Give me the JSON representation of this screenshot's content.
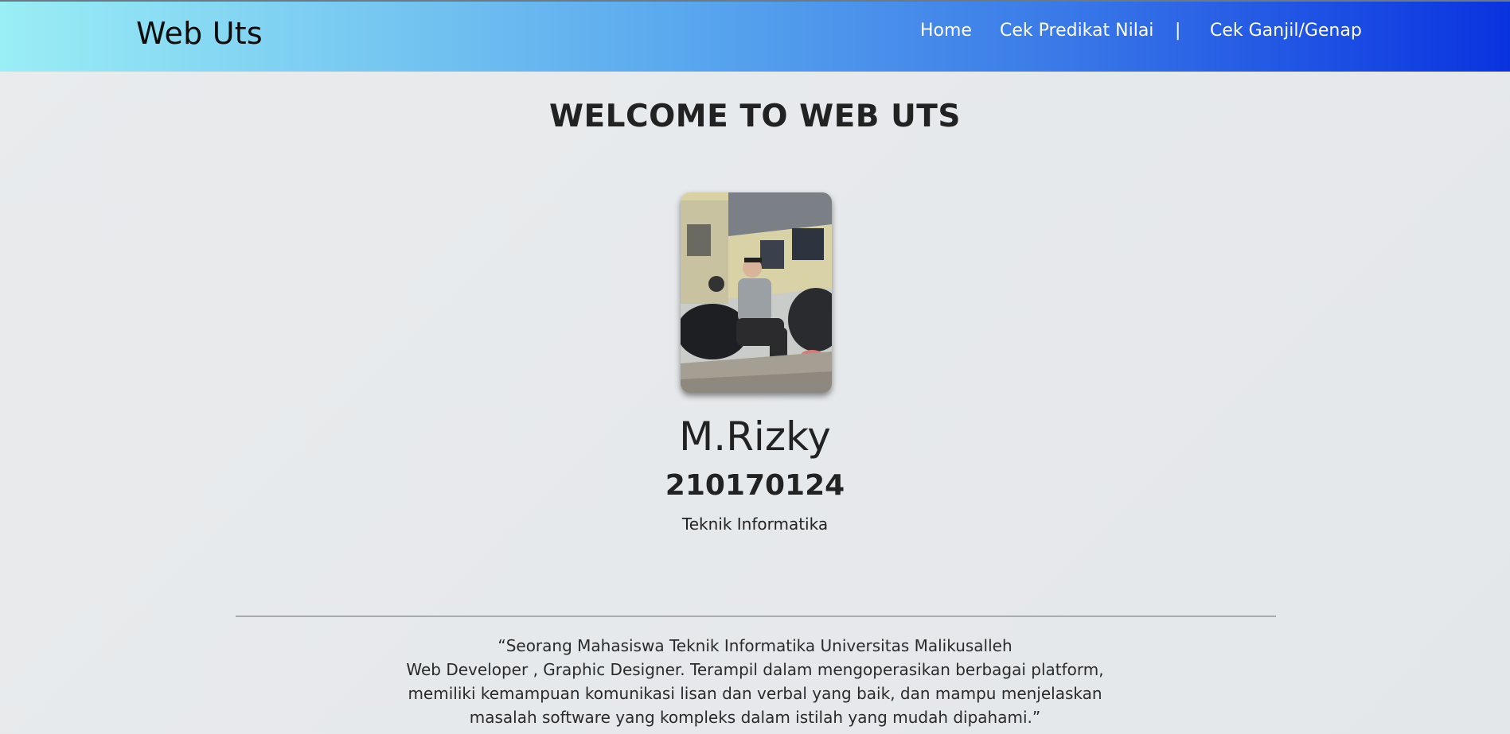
{
  "header": {
    "brand": "Web Uts",
    "nav": {
      "home": "Home",
      "predikat": "Cek Predikat Nilai",
      "separator": "|",
      "ganjil": "Cek Ganjil/Genap"
    }
  },
  "main": {
    "welcome": "WELCOME TO WEB UTS",
    "profile_photo": "profile-photo",
    "name": "M.Rizky",
    "nim": "210170124",
    "major": "Teknik Informatika",
    "quote": [
      "“Seorang Mahasiswa Teknik Informatika Universitas Malikusalleh",
      "Web Developer , Graphic Designer. Terampil dalam mengoperasikan berbagai platform,",
      "memiliki kemampuan komunikasi lisan dan verbal yang baik, dan mampu menjelaskan",
      "masalah software yang kompleks dalam istilah yang mudah dipahami.”"
    ]
  },
  "colors": {
    "header_start": "#9aeef5",
    "header_end": "#0a33e0",
    "background": "#e7e9ec",
    "text": "#222222"
  }
}
